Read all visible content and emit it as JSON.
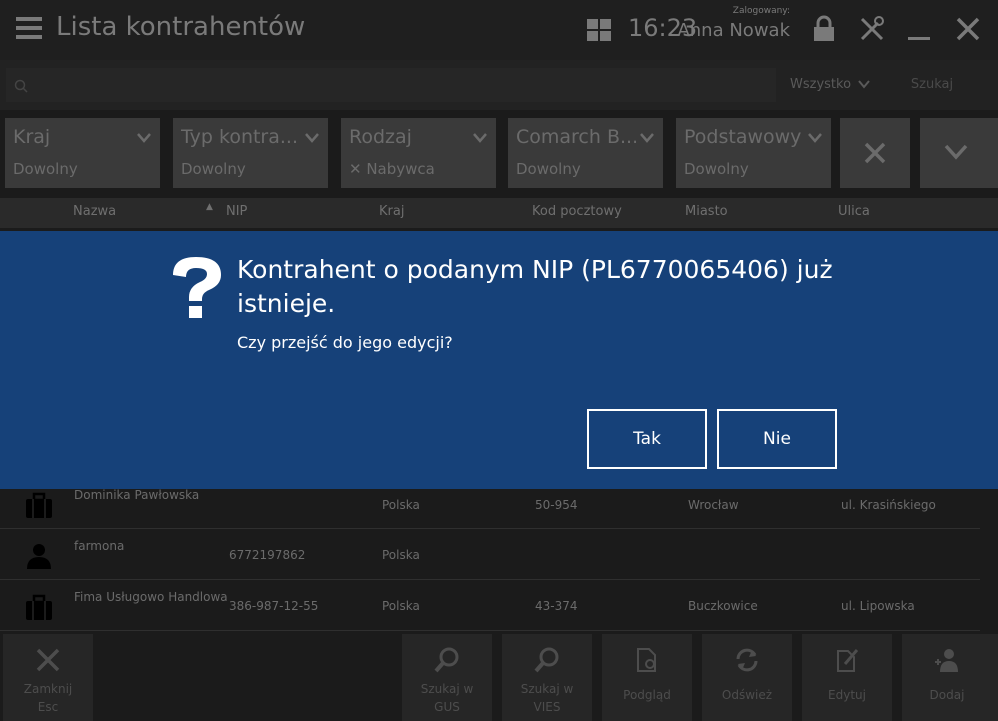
{
  "titlebar": {
    "title": "Lista kontrahentów",
    "clock": "16:23",
    "logged_in_caption": "Zalogowany:",
    "user_name": "Anna Nowak"
  },
  "search": {
    "placeholder": "",
    "filter_value": "Wszystko",
    "search_button": "Szukaj"
  },
  "filters": [
    {
      "label": "Kraj",
      "value": "Dowolny"
    },
    {
      "label": "Typ kontra...",
      "value": "Dowolny"
    },
    {
      "label": "Rodzaj",
      "value": "✕ Nabywca"
    },
    {
      "label": "Comarch B...",
      "value": "Dowolny"
    },
    {
      "label": "Podstawowy",
      "value": "Dowolny"
    }
  ],
  "table": {
    "columns": [
      "Nazwa",
      "NIP",
      "Kraj",
      "Kod pocztowy",
      "Miasto",
      "Ulica"
    ],
    "rows": [
      {
        "icon": "briefcase-icon",
        "name": "Dominika Pawłowska",
        "nip": "",
        "country": "Polska",
        "postal": "50-954",
        "city": "Wrocław",
        "street": "ul. Krasińskiego"
      },
      {
        "icon": "person-icon",
        "name": "farmona",
        "nip": "6772197862",
        "country": "Polska",
        "postal": "",
        "city": "",
        "street": ""
      },
      {
        "icon": "briefcase-icon",
        "name": "Fima Usługowo Handlowa",
        "nip": "386-987-12-55",
        "country": "Polska",
        "postal": "43-374",
        "city": "Buczkowice",
        "street": "ul. Lipowska"
      }
    ]
  },
  "bottombar": {
    "close": "Zamknij",
    "close_key": "Esc",
    "gus_line1": "Szukaj w",
    "gus_line2": "GUS",
    "vies_line1": "Szukaj w",
    "vies_line2": "VIES",
    "preview": "Podgląd",
    "refresh": "Odśwież",
    "edit": "Edytuj",
    "add": "Dodaj"
  },
  "dialog": {
    "message": "Kontrahent o podanym NIP (PL6770065406) już istnieje.",
    "question": "Czy przejść do jego edycji?",
    "yes": "Tak",
    "no": "Nie"
  },
  "colors": {
    "dialog_bg": "#164179",
    "app_bg": "#1b1b1b"
  }
}
